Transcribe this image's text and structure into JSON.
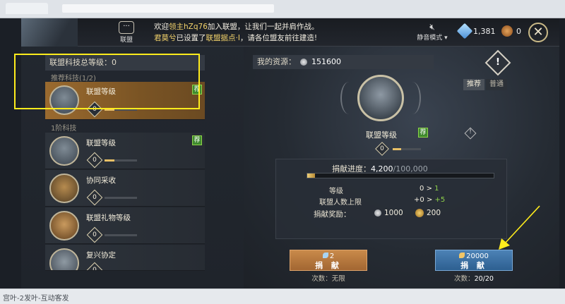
{
  "browser": {
    "taskbar_text": "宫叶-2发叶-互动客发"
  },
  "topbar": {
    "alliance_label": "联盟",
    "chat_line1_prefix": "欢迎",
    "chat_line1_name": "领主hZq76",
    "chat_line1_suffix": "加入联盟，让我们一起并肩作战。",
    "chat_line2_name": "君莫兮",
    "chat_line2_mid": "已设置了",
    "chat_line2_target": "联盟据点·I",
    "chat_line2_suffix": "，请各位盟友前往建造!",
    "mute_label": "静音模式",
    "crystal_count": "1,381",
    "gem_count": "0",
    "close_symbol": "✕"
  },
  "left_panel": {
    "total_level_label": "联盟科技总等级：0",
    "recommended_section": "推荐科技(1/2)",
    "tier1_section": "1阶科技",
    "rec_badge": "荐",
    "items": [
      {
        "name": "联盟等级",
        "level": "0",
        "recommended": true,
        "progress": 0.3
      },
      {
        "name": "联盟等级",
        "level": "0",
        "recommended": true,
        "progress": 0.3
      },
      {
        "name": "协同采收",
        "level": "0",
        "recommended": false,
        "progress": 0.0
      },
      {
        "name": "联盟礼物等级",
        "level": "0",
        "recommended": false,
        "progress": 0.0
      },
      {
        "name": "复兴协定",
        "level": "0",
        "recommended": false,
        "progress": 0.0
      }
    ]
  },
  "right_panel": {
    "resource_label": "我的资源：",
    "resource_value": "151600",
    "info_symbol": "!",
    "tab_recommended": "推荐",
    "tab_normal": "普通",
    "hero_name": "联盟等级",
    "hero_rec_badge": "荐",
    "hero_info_symbol": "!",
    "hero_level": "0",
    "hero_level_progress": 0.3,
    "donate_progress_label": "捐献进度：",
    "donate_progress_current": "4,200",
    "donate_progress_max": "/100,000",
    "donate_progress_ratio": 0.042,
    "stats": {
      "level_label": "等级",
      "level_from": "0",
      "level_arrow": ">",
      "level_to": "1",
      "members_label": "联盟人数上限",
      "members_from": "+0",
      "members_arrow": ">",
      "members_to": "+5"
    },
    "reward_label": "捐献奖励：",
    "reward_silver": "1000",
    "reward_coin": "200",
    "btn_left_cost": "2",
    "btn_left_label": "捐 献",
    "btn_right_cost": "20000",
    "btn_right_label": "捐 献",
    "count_left": "次数：无限",
    "count_right_label": "次数：",
    "count_right_value": "20/20"
  }
}
